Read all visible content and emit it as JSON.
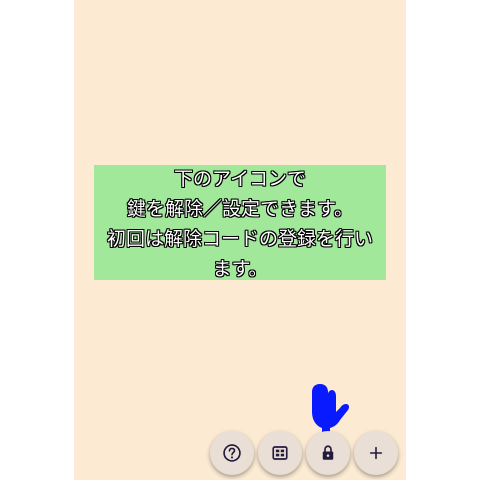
{
  "hint": {
    "line1": "下のアイコンで",
    "line2": "鍵を解除／設定できます。",
    "line3": "初回は解除コードの登録を行い",
    "line4": "ます。"
  },
  "fabs": [
    {
      "id": "help",
      "icon": "help-icon"
    },
    {
      "id": "grid",
      "icon": "grid-icon"
    },
    {
      "id": "lock",
      "icon": "lock-icon"
    },
    {
      "id": "add",
      "icon": "plus-icon"
    }
  ],
  "colors": {
    "background": "#fcebd2",
    "hint_panel": "#a2e89b",
    "fab": "#e9dfd6",
    "icon": "#241a3c",
    "pointer": "#0a1aff"
  }
}
